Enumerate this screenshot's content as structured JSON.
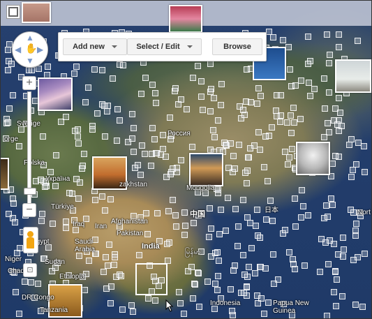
{
  "map": {
    "labels": {
      "russia": "Россия",
      "sverige": "Sverige",
      "norge": "orge",
      "polska": "Polska",
      "ukraina": "Україна",
      "kazakhstan": "zakhstan",
      "mongolia": "Mongolia",
      "china": "中国",
      "japan": "日本",
      "turkiye": "Türkiye",
      "iraq": "Iraq",
      "iran": "Iran",
      "afghanistan": "Afghanistan",
      "pakistan": "Pakistan",
      "saudi": "Saudi\nArabia",
      "india": "India",
      "myanmar": "မြန်မာ",
      "sudan": "Sudan",
      "niger": "Niger",
      "ethiopia": "Ethiopia",
      "drcongo": "DR Congo",
      "indonesia": "Indonesia",
      "png": "Papua New\nGuinea",
      "north": "Nort",
      "tanzania": "Tanzania",
      "chad": "Chad",
      "egypt": "Egypt"
    }
  },
  "toolbar": {
    "add_new": "Add new",
    "select_edit": "Select / Edit",
    "browse": "Browse"
  },
  "controls": {
    "zoom_in": "+",
    "zoom_out": "−",
    "zoom_level": 0.92
  },
  "colors": {
    "ocean": "#1f3a68",
    "pegman": "#f2a512"
  }
}
